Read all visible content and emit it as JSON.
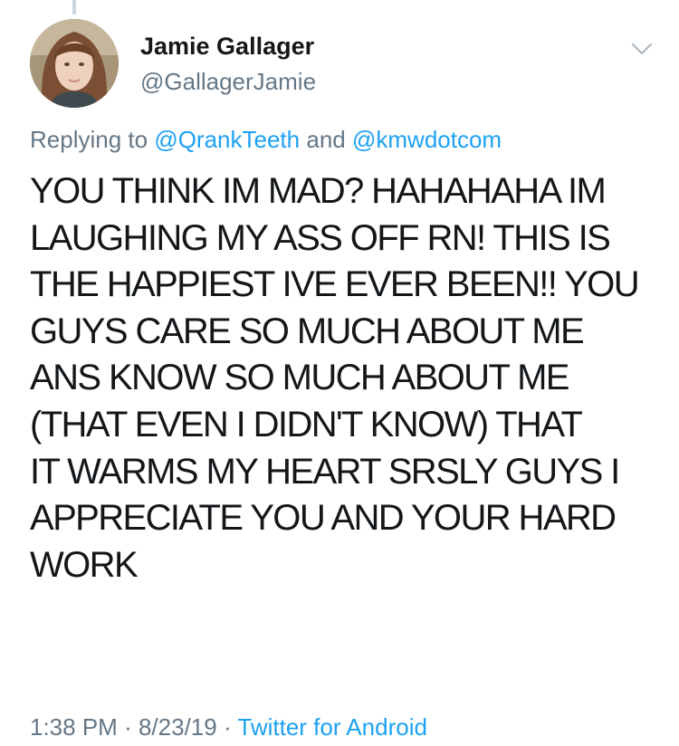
{
  "author": {
    "name": "Jamie Gallager",
    "handle": "@GallagerJamie",
    "avatar_icon": "profile-photo"
  },
  "menu": {
    "icon": "chevron-down-icon"
  },
  "reply": {
    "prefix": "Replying to",
    "to": [
      "@QrankTeeth",
      "@kmwdotcom"
    ],
    "conjunction": "and"
  },
  "tweet": {
    "lines": [
      "YOU THINK IM MAD? HAHAHAHA IM",
      "LAUGHING MY ASS OFF RN! THIS IS",
      "THE HAPPIEST IVE EVER BEEN!! YOU",
      "GUYS CARE SO MUCH ABOUT ME",
      "ANS KNOW SO MUCH ABOUT ME",
      "(THAT EVEN I DIDN'T KNOW) THAT",
      "IT WARMS MY HEART SRSLY GUYS I",
      "APPRECIATE YOU AND YOUR HARD",
      "WORK"
    ]
  },
  "meta": {
    "time": "1:38 PM",
    "separator": "·",
    "date": "8/23/19",
    "source": "Twitter for Android"
  },
  "colors": {
    "text": "#14171a",
    "secondary": "#657786",
    "link": "#1da1f2",
    "divider": "#ccd6dd"
  }
}
